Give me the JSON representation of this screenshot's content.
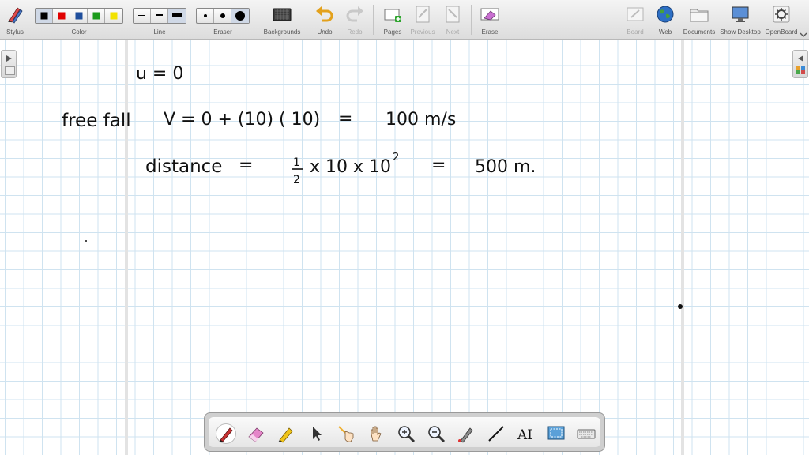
{
  "toolbar": {
    "stylus_label": "Stylus",
    "color_label": "Color",
    "line_label": "Line",
    "eraser_label": "Eraser",
    "backgrounds_label": "Backgrounds",
    "undo_label": "Undo",
    "redo_label": "Redo",
    "pages_label": "Pages",
    "previous_label": "Previous",
    "next_label": "Next",
    "erase_label": "Erase",
    "board_label": "Board",
    "web_label": "Web",
    "documents_label": "Documents",
    "show_desktop_label": "Show Desktop",
    "openboard_label": "OpenBoard",
    "colors": [
      "#000000",
      "#e00000",
      "#1f4e9c",
      "#1a9a1a",
      "#f2e200"
    ],
    "selected_color": "#000000",
    "line_widths": [
      "thin",
      "medium",
      "thick"
    ],
    "eraser_sizes": [
      "small",
      "medium",
      "large"
    ]
  },
  "board": {
    "grid_color": "#cfe3f0",
    "ink_color": "#111111",
    "handwriting": {
      "line1": "u = 0",
      "line2_label": "free fall",
      "line2_eq1": "V  =  0 + (10) ( 10)",
      "line2_eq2": "=",
      "line2_result": "100  m/s",
      "line3_label": "distance",
      "line3_eq": "=",
      "line3_frac_num": "1",
      "line3_frac_den": "2",
      "line3_mid": "x   10 x  10",
      "line3_exp": "2",
      "line3_eq2": "=",
      "line3_result": "500  m."
    }
  },
  "palette": {
    "tools": [
      "pen-icon",
      "eraser-icon",
      "marker-icon",
      "selector-icon",
      "interactive-pointer-icon",
      "hand-icon",
      "zoom-in-icon",
      "zoom-out-icon",
      "laser-pointer-icon",
      "line-icon",
      "text-icon",
      "capture-icon",
      "keyboard-icon"
    ],
    "text_tool_label": "AI",
    "selected_tool": "pen-icon"
  }
}
